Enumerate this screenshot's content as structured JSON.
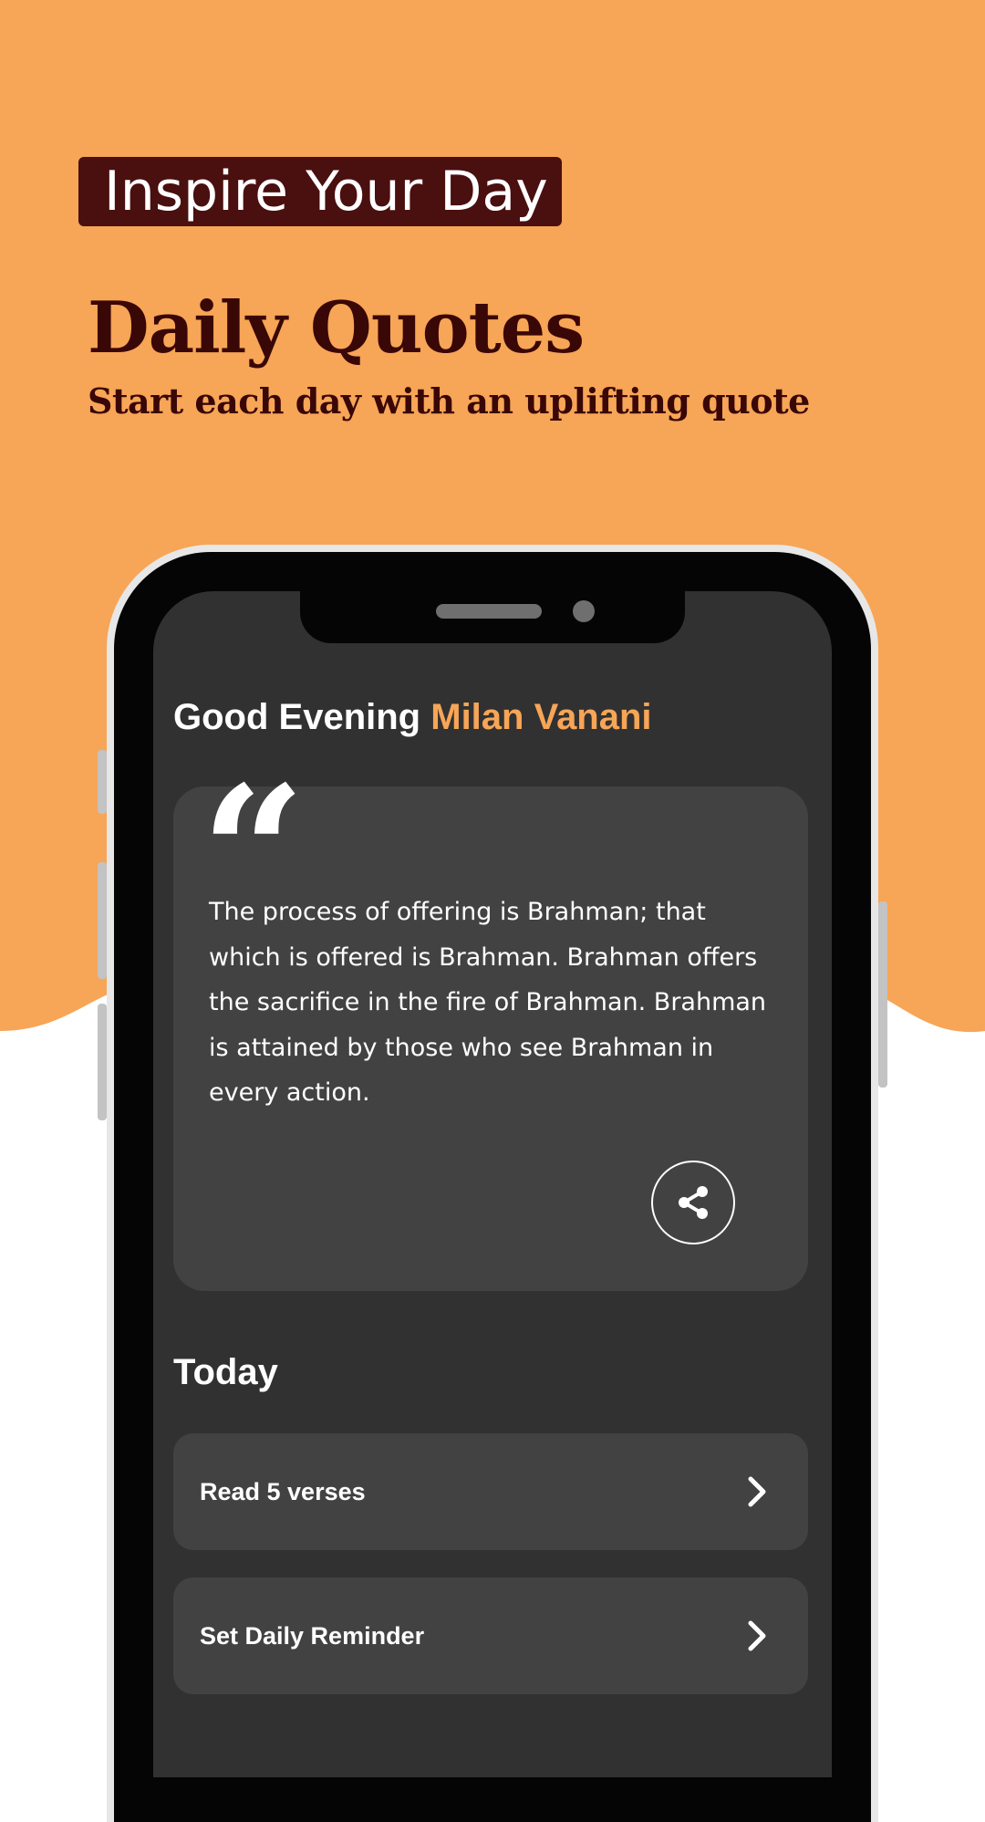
{
  "colors": {
    "brand_orange": "#F7A556",
    "maroon": "#4A0F0F",
    "screen_bg": "#313131",
    "card_bg": "#424242"
  },
  "promo": {
    "tag": "Inspire Your Day",
    "headline": "Daily Quotes",
    "subheadline": "Start each day with an uplifting quote"
  },
  "app": {
    "greeting": {
      "prefix": "Good Evening",
      "name": "Milan Vanani"
    },
    "quote": {
      "text": "The process of offering is Brahman; that which is offered is Brahman. Brahman offers the sacrifice in the fire of Brahman. Brahman is attained by those who see Brahman in every action.",
      "mark_icon": "quote-mark-icon",
      "share_icon": "share-icon"
    },
    "today": {
      "title": "Today",
      "items": [
        {
          "label": "Read 5 verses",
          "icon": "chevron-right-icon"
        },
        {
          "label": "Set Daily Reminder",
          "icon": "chevron-right-icon"
        }
      ]
    }
  }
}
